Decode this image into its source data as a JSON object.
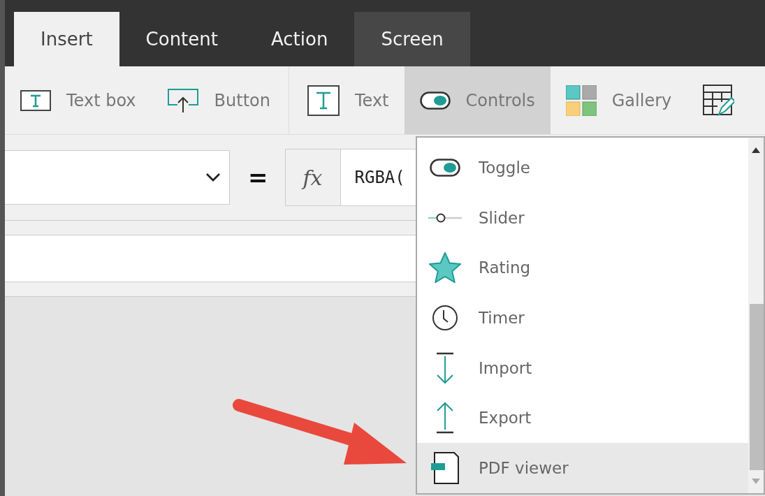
{
  "tabs": [
    {
      "label": "Insert",
      "selected": true,
      "highlighted": false
    },
    {
      "label": "Content",
      "selected": false,
      "highlighted": false
    },
    {
      "label": "Action",
      "selected": false,
      "highlighted": false
    },
    {
      "label": "Screen",
      "selected": false,
      "highlighted": true
    }
  ],
  "toolbar": [
    {
      "kind": "textbox",
      "label": "Text box",
      "selected": false
    },
    {
      "kind": "button",
      "label": "Button",
      "selected": false
    },
    {
      "kind": "separator"
    },
    {
      "kind": "text",
      "label": "Text",
      "selected": false
    },
    {
      "kind": "controls",
      "label": "Controls",
      "selected": true
    },
    {
      "kind": "gallery",
      "label": "Gallery",
      "selected": false
    },
    {
      "kind": "forms"
    }
  ],
  "formula_bar": {
    "equals": "=",
    "fx": "fx",
    "value": "RGBA("
  },
  "controls_menu": [
    {
      "kind": "toggle",
      "label": "Toggle",
      "selected": false
    },
    {
      "kind": "slider",
      "label": "Slider",
      "selected": false
    },
    {
      "kind": "rating",
      "label": "Rating",
      "selected": false
    },
    {
      "kind": "timer",
      "label": "Timer",
      "selected": false
    },
    {
      "kind": "import",
      "label": "Import",
      "selected": false
    },
    {
      "kind": "export",
      "label": "Export",
      "selected": false
    },
    {
      "kind": "pdf",
      "label": "PDF viewer",
      "selected": true
    }
  ]
}
